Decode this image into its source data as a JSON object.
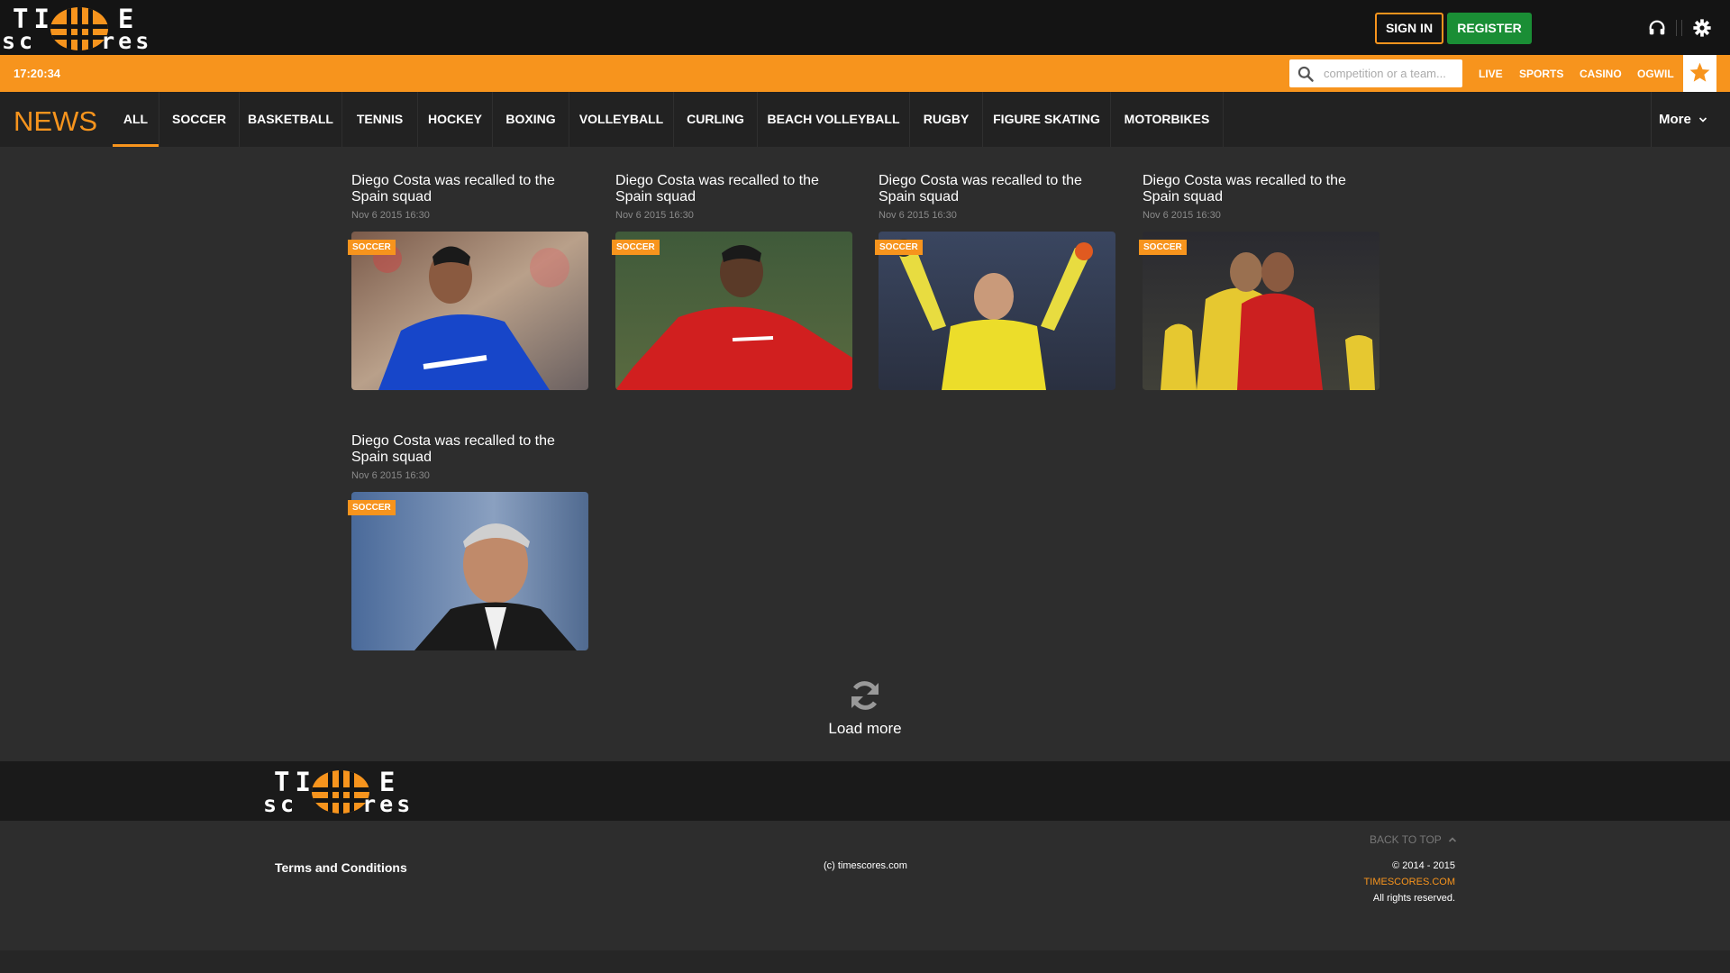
{
  "header": {
    "logo_top": "TI E",
    "logo_bottom": "sc res",
    "signin_label": "SIGN IN",
    "register_label": "REGISTER",
    "icons": [
      "headphones-icon",
      "gear-icon"
    ]
  },
  "ticker": {
    "clock": "17:20:34",
    "search_placeholder": "competition or a team...",
    "links": [
      "LIVE",
      "SPORTS",
      "CASINO",
      "OGWIL"
    ]
  },
  "nav": {
    "section_title": "NEWS",
    "tabs": [
      "ALL",
      "SOCCER",
      "BASKETBALL",
      "TENNIS",
      "HOCKEY",
      "BOXING",
      "VOLLEYBALL",
      "CURLING",
      "BEACH VOLLEYBALL",
      "RUGBY",
      "FIGURE SKATING",
      "MOTORBIKES"
    ],
    "active_tab": "ALL",
    "more_label": "More"
  },
  "articles": [
    {
      "title": "Diego Costa was recalled to the Spain squad",
      "date": "Nov 6 2015 16:30",
      "category": "SOCCER",
      "image": "player in blue jersey"
    },
    {
      "title": "Diego Costa was recalled to the Spain squad",
      "date": "Nov 6 2015 16:30",
      "category": "SOCCER",
      "image": "player in red jersey"
    },
    {
      "title": "Diego Costa was recalled to the Spain squad",
      "date": "Nov 6 2015 16:30",
      "category": "SOCCER",
      "image": "goalkeeper in yellow celebrating"
    },
    {
      "title": "Diego Costa was recalled to the Spain squad",
      "date": "Nov 6 2015 16:30",
      "category": "SOCCER",
      "image": "players embracing"
    },
    {
      "title": "Diego Costa was recalled to the Spain squad",
      "date": "Nov 6 2015 16:30",
      "category": "SOCCER",
      "image": "manager portrait"
    }
  ],
  "load_more": "Load more",
  "footer": {
    "terms": "Terms and Conditions",
    "copyright_center": "(c) timescores.com",
    "back_to_top": "BACK TO TOP",
    "years": "© 2014 - 2015",
    "site": "TIMESCORES.COM",
    "rights": "All rights reserved."
  },
  "colors": {
    "accent": "#f7941d",
    "register": "#1a8e35",
    "background": "#2d2d2d"
  }
}
